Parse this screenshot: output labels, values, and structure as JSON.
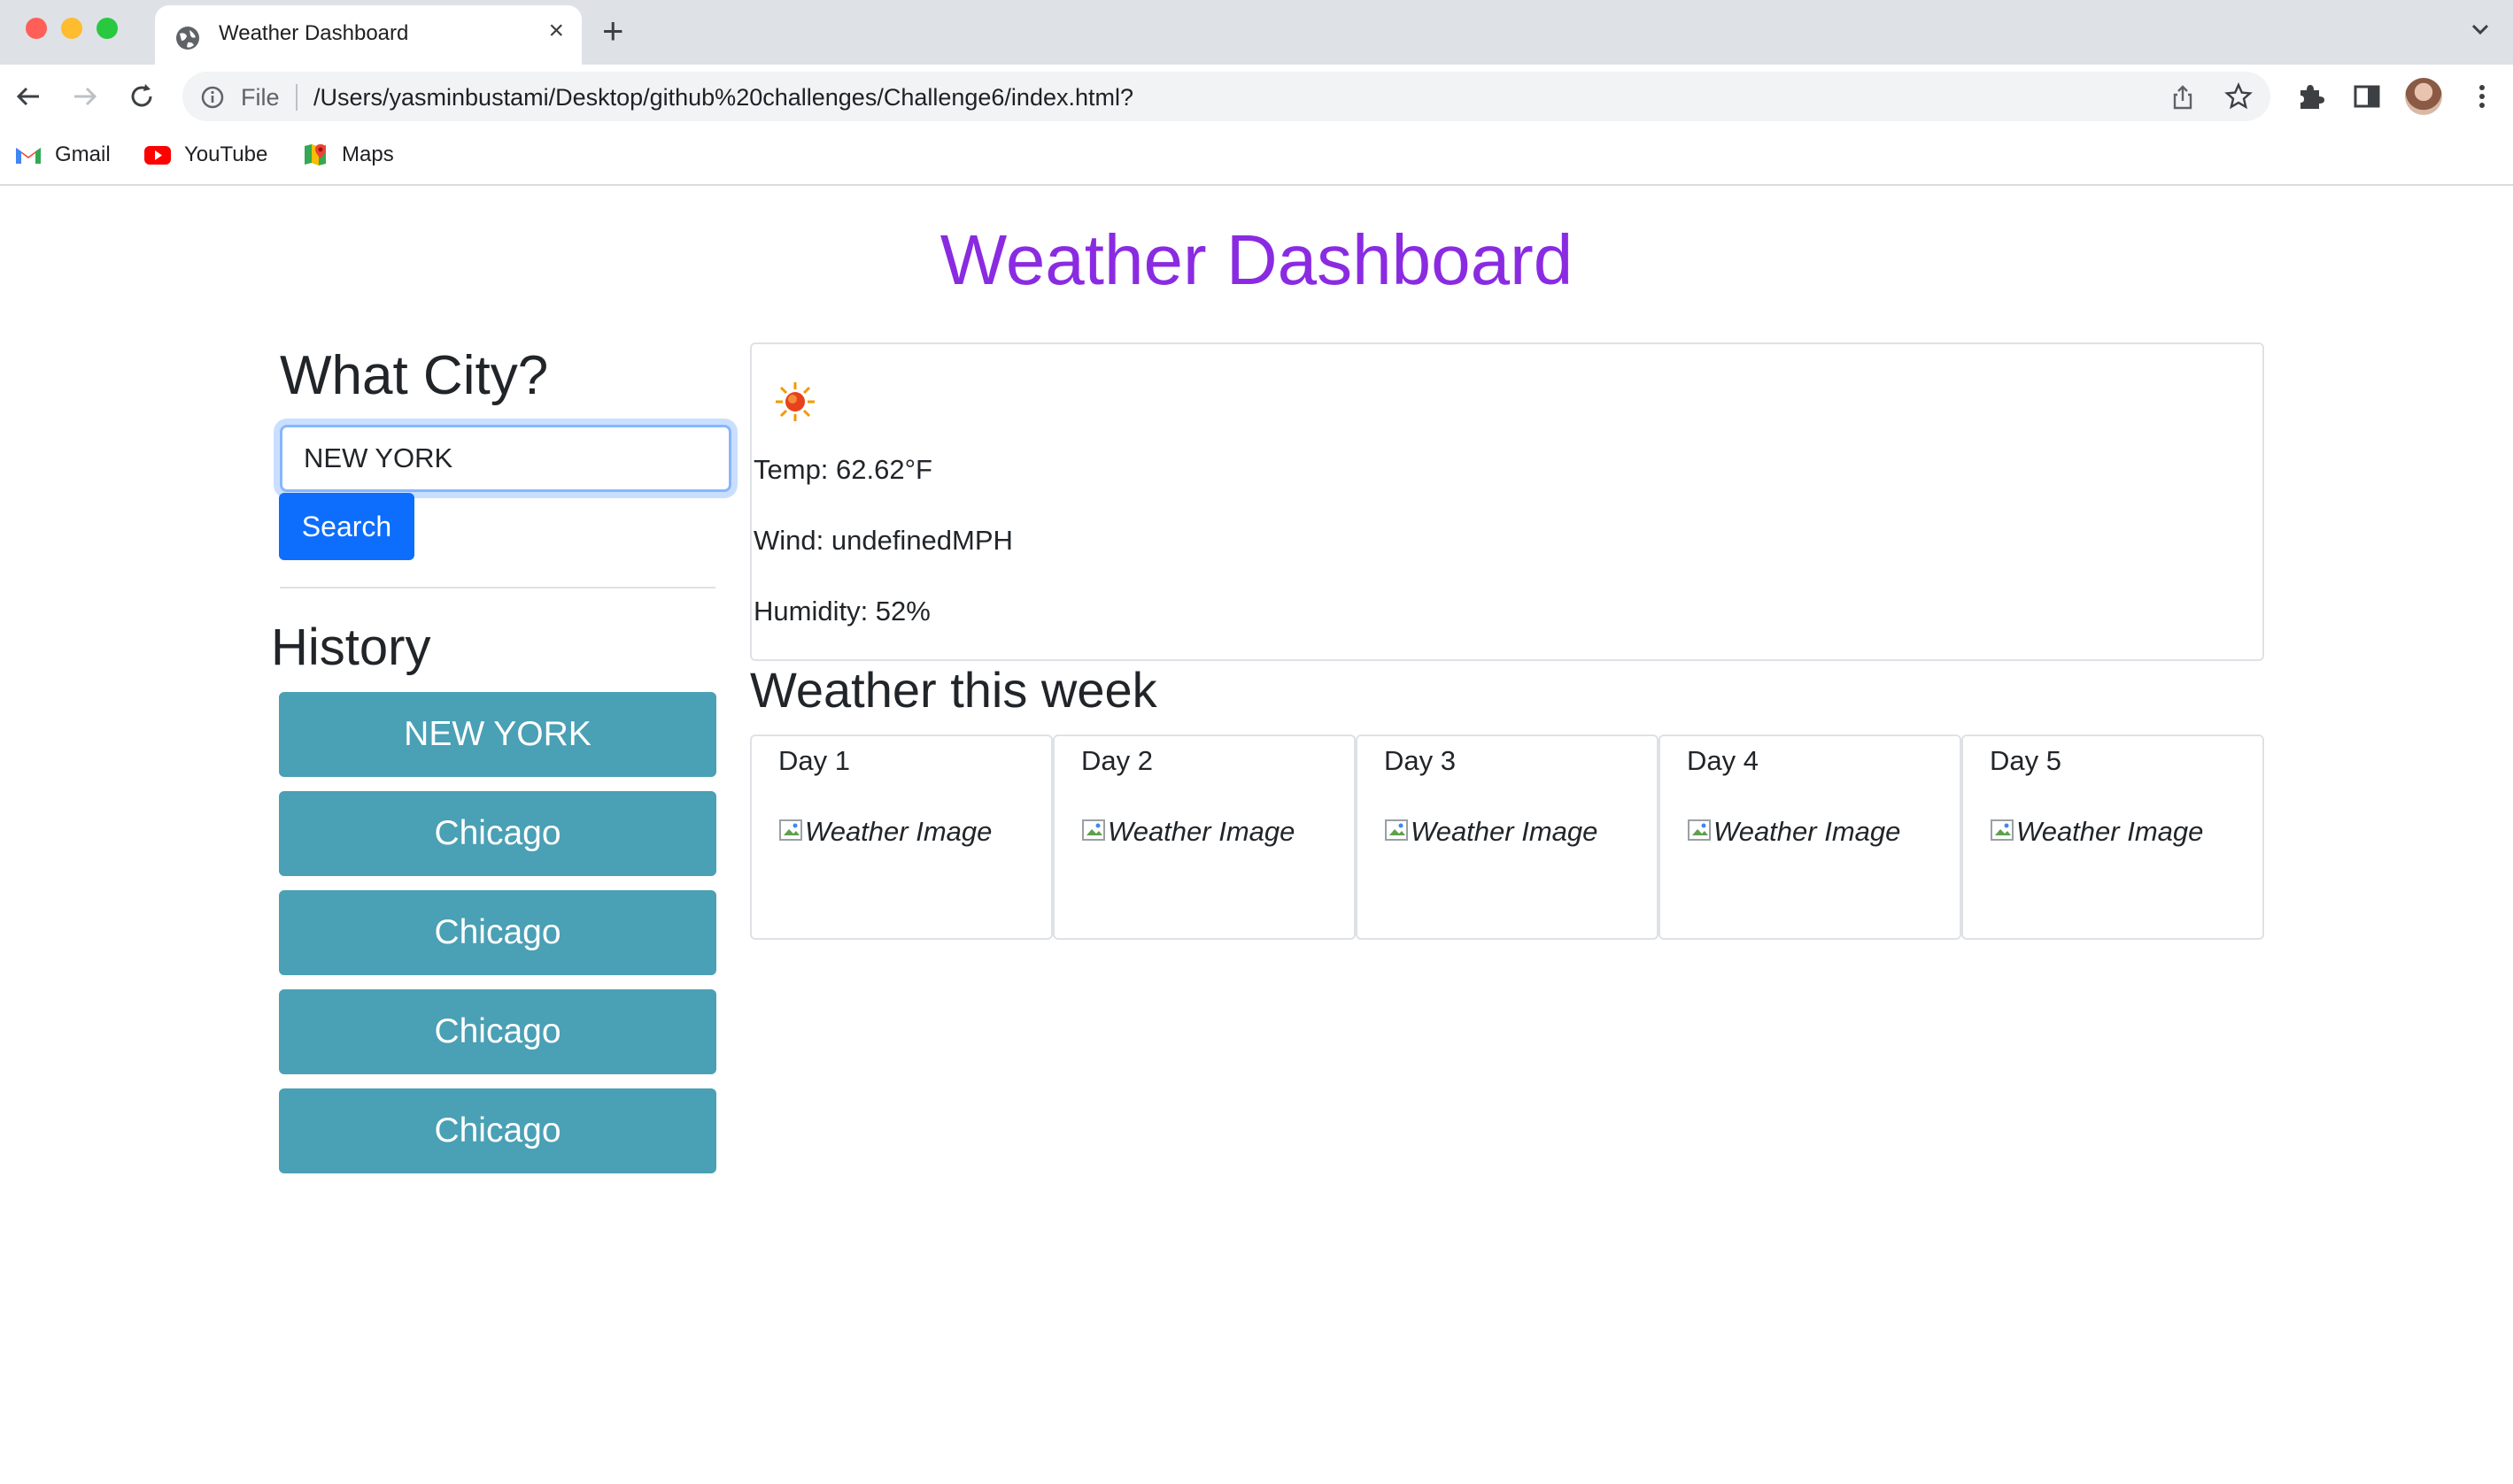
{
  "browser": {
    "tab_title": "Weather Dashboard",
    "new_tab_label": "+",
    "close_label": "×",
    "address_scheme": "File",
    "url": "/Users/yasminbustami/Desktop/github%20challenges/Challenge6/index.html?",
    "bookmarks": [
      {
        "label": "Gmail",
        "icon": "gmail-icon"
      },
      {
        "label": "YouTube",
        "icon": "youtube-icon"
      },
      {
        "label": "Maps",
        "icon": "maps-icon"
      }
    ]
  },
  "page": {
    "title": "Weather Dashboard",
    "aside_heading": "What City?",
    "search_value": "NEW YORK",
    "search_button": "Search",
    "history_heading": "History",
    "history": [
      "NEW YORK",
      "Chicago",
      "Chicago",
      "Chicago",
      "Chicago"
    ]
  },
  "current": {
    "icon": "sun-icon",
    "temp": "Temp: 62.62°F",
    "wind": "Wind: undefinedMPH",
    "humidity": "Humidity: 52%"
  },
  "forecast": {
    "heading": "Weather this week",
    "days": [
      {
        "label": "Day 1",
        "img_alt": "Weather Image"
      },
      {
        "label": "Day 2",
        "img_alt": "Weather Image"
      },
      {
        "label": "Day 3",
        "img_alt": "Weather Image"
      },
      {
        "label": "Day 4",
        "img_alt": "Weather Image"
      },
      {
        "label": "Day 5",
        "img_alt": "Weather Image"
      }
    ]
  },
  "colors": {
    "title": "#8a2be2",
    "search_button": "#0d6efd",
    "history_button": "#4aa0b5"
  }
}
